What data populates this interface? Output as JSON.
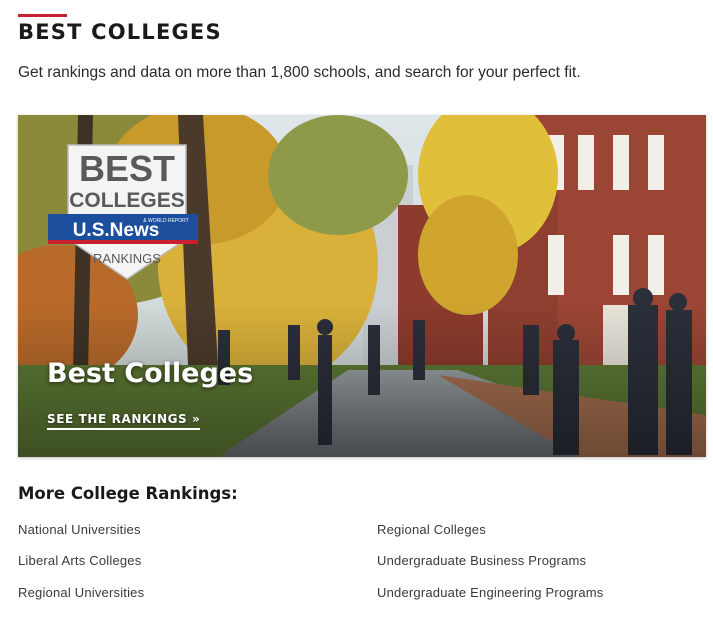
{
  "header": {
    "title": "BEST COLLEGES",
    "subtitle": "Get rankings and data on more than 1,800 schools, and search for your perfect fit."
  },
  "hero": {
    "badge": {
      "line1": "BEST",
      "line2": "COLLEGES",
      "brand": "U.S.News",
      "brand_small": "& WORLD REPORT",
      "label": "RANKINGS"
    },
    "title": "Best Colleges",
    "cta_label": "SEE THE RANKINGS »"
  },
  "more": {
    "heading": "More College Rankings:",
    "links": [
      "National Universities",
      "Regional Colleges",
      "Liberal Arts Colleges",
      "Undergraduate Business Programs",
      "Regional Universities",
      "Undergraduate Engineering Programs"
    ]
  },
  "colors": {
    "accent_red": "#c8202f",
    "badge_blue": "#1b4e9c"
  }
}
